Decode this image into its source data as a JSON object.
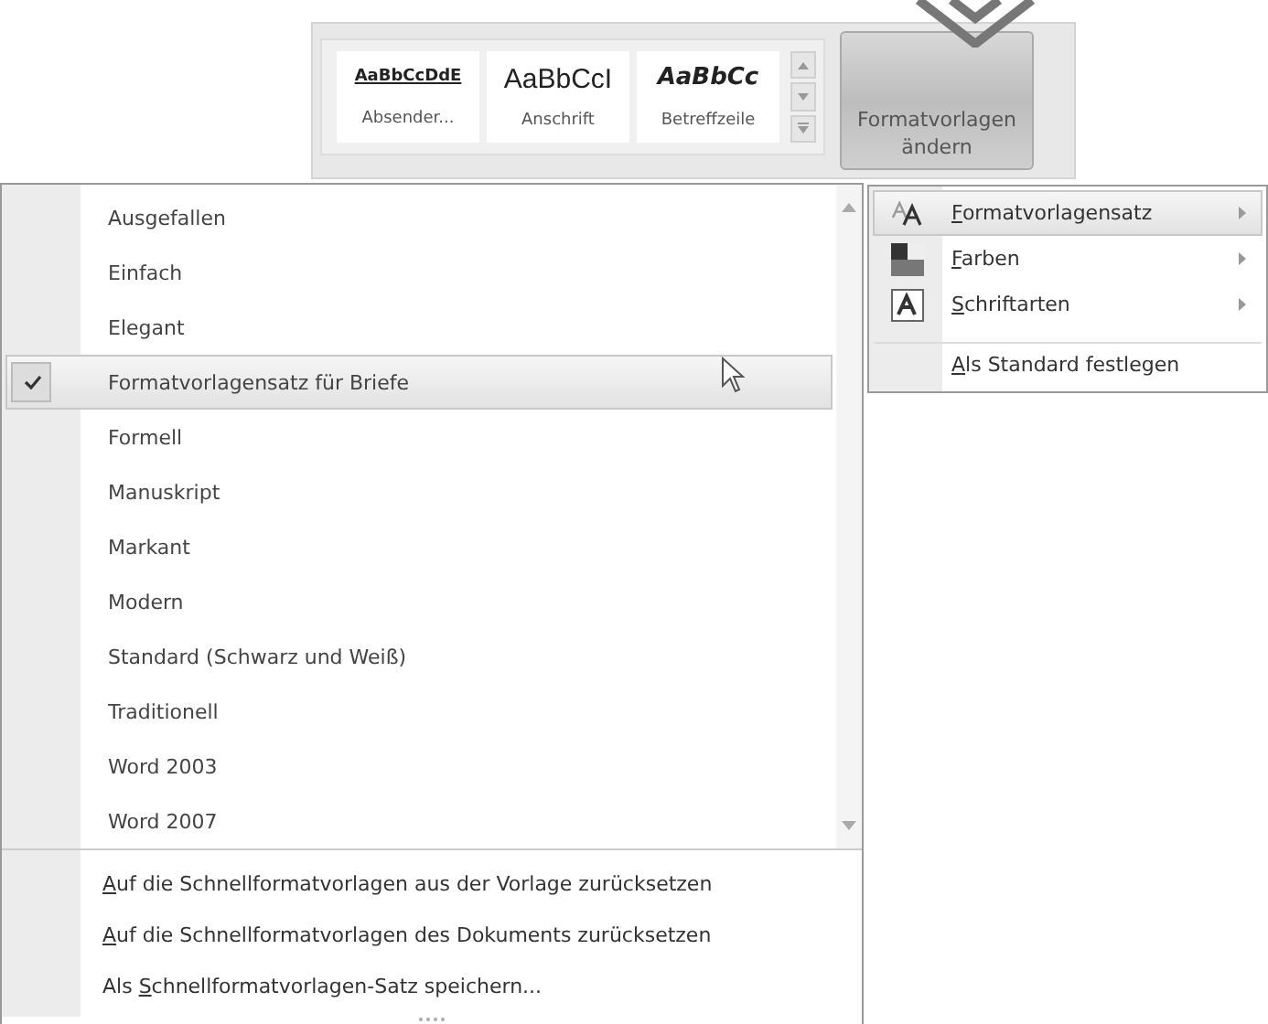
{
  "gallery": {
    "items": [
      {
        "kind": "underlined",
        "sample": "AaBbCcDdE",
        "label": "Absender..."
      },
      {
        "kind": "plain",
        "sample": "AaBbCcI",
        "label": "Anschrift"
      },
      {
        "kind": "bolditalic",
        "sample": "AaBbCc",
        "label": "Betreffzeile"
      }
    ]
  },
  "change_styles_button": {
    "label": "Formatvorlagen ändern"
  },
  "style_sets": {
    "items": [
      {
        "label": "Ausgefallen",
        "checked": false,
        "selected": false
      },
      {
        "label": "Einfach",
        "checked": false,
        "selected": false
      },
      {
        "label": "Elegant",
        "checked": false,
        "selected": false
      },
      {
        "label": "Formatvorlagensatz für Briefe",
        "checked": true,
        "selected": true
      },
      {
        "label": "Formell",
        "checked": false,
        "selected": false
      },
      {
        "label": "Manuskript",
        "checked": false,
        "selected": false
      },
      {
        "label": "Markant",
        "checked": false,
        "selected": false
      },
      {
        "label": "Modern",
        "checked": false,
        "selected": false
      },
      {
        "label": "Standard (Schwarz und Weiß)",
        "checked": false,
        "selected": false
      },
      {
        "label": "Traditionell",
        "checked": false,
        "selected": false
      },
      {
        "label": "Word 2003",
        "checked": false,
        "selected": false
      },
      {
        "label": "Word 2007",
        "checked": false,
        "selected": false
      }
    ],
    "commands": [
      {
        "key": "A",
        "rest": "uf die Schnellformatvorlagen aus der Vorlage zurücksetzen"
      },
      {
        "key": "A",
        "rest": "uf die Schnellformatvorlagen des Dokuments zurücksetzen"
      },
      {
        "prefix": "Als ",
        "key": "S",
        "rest": "chnellformatvorlagen-Satz speichern..."
      }
    ]
  },
  "submenu": {
    "items": [
      {
        "kind": "styleset",
        "key": "F",
        "rest": "ormatvorlagensatz",
        "submenu": true,
        "selected": true
      },
      {
        "kind": "colors",
        "key": "F",
        "rest": "arben",
        "submenu": true,
        "selected": false
      },
      {
        "kind": "fonts",
        "key": "S",
        "rest": "chriftarten",
        "submenu": true,
        "selected": false
      },
      {
        "kind": "none",
        "key": "A",
        "rest": "ls Standard festlegen",
        "submenu": false,
        "selected": false
      }
    ]
  }
}
